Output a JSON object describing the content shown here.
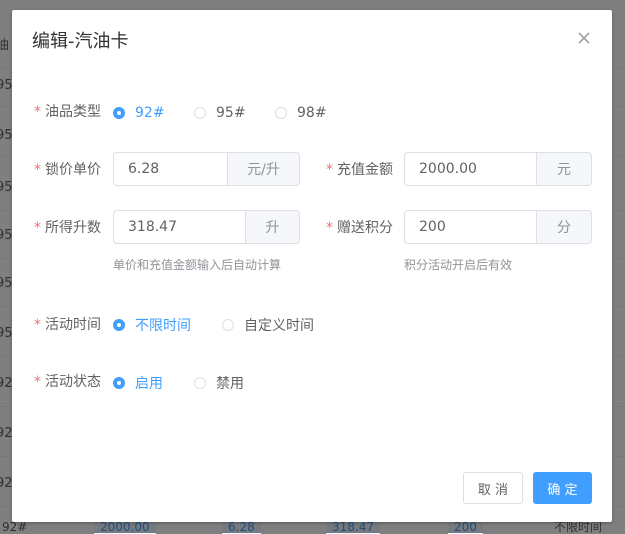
{
  "background": {
    "row_fragments": [
      "油",
      "95",
      "95",
      "95",
      "95",
      "95",
      "95",
      "92",
      "92",
      "92",
      "92"
    ],
    "bottom_row": [
      "92#",
      "2000.00",
      "6.28",
      "318.47",
      "200",
      "不限时间"
    ]
  },
  "dialog": {
    "title": "编辑-汽油卡",
    "fuel_type": {
      "label": "油品类型",
      "options": [
        "92#",
        "95#",
        "98#"
      ],
      "selected": "92#"
    },
    "lock_price": {
      "label": "锁价单价",
      "value": "6.28",
      "unit": "元/升"
    },
    "recharge_amount": {
      "label": "充值金额",
      "value": "2000.00",
      "unit": "元"
    },
    "liters": {
      "label": "所得升数",
      "value": "318.47",
      "unit": "升",
      "hint": "单价和充值金额输入后自动计算"
    },
    "bonus_points": {
      "label": "赠送积分",
      "value": "200",
      "unit": "分",
      "hint": "积分活动开启后有效"
    },
    "activity_time": {
      "label": "活动时间",
      "options": [
        "不限时间",
        "自定义时间"
      ],
      "selected": "不限时间"
    },
    "activity_status": {
      "label": "活动状态",
      "options": [
        "启用",
        "禁用"
      ],
      "selected": "启用"
    },
    "buttons": {
      "cancel": "取 消",
      "confirm": "确 定"
    }
  },
  "colors": {
    "primary": "#409eff",
    "required": "#f56c6c",
    "text": "#606266",
    "muted": "#909399"
  },
  "icons": {
    "close": "close-icon"
  }
}
